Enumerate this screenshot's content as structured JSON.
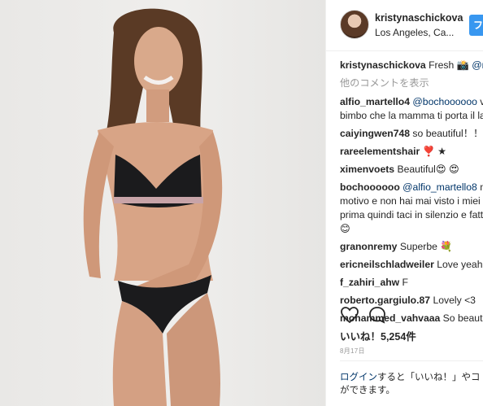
{
  "post": {
    "username": "kristynaschickova",
    "location": "Los Angeles, Ca...",
    "follow_label": "フ"
  },
  "caption": {
    "username": "kristynaschickova",
    "text": " Fresh 📸 ",
    "mention": "@n"
  },
  "view_more": "他のコメントを表示",
  "comments": [
    {
      "username": "alfio_martello4",
      "mention": " @bochoooooo",
      "text": " va",
      "line2": "bimbo che la mamma ti porta il la"
    },
    {
      "username": "caiyingwen748",
      "text": " so beautiful！！"
    },
    {
      "username": "rareelementshair",
      "text": " ❣️ ★"
    },
    {
      "username": "ximenvoets",
      "text": " Beautiful😍 😍"
    },
    {
      "username": "bochoooooo",
      "mention": " @alfio_martello8",
      "text": " no",
      "line2": "motivo e non hai mai visto i miei c",
      "line3": "prima quindi taci in silenzio e fatt",
      "line4": "😊"
    },
    {
      "username": "granonremy",
      "text": " Superbe 💐"
    },
    {
      "username": "ericneilschladweiler",
      "text": " Love yeah"
    },
    {
      "username": "f_zahiri_ahw",
      "text": " F"
    },
    {
      "username": "roberto.gargiulo.87",
      "text": " Lovely <3"
    },
    {
      "username": "mohammed_vahvaaa",
      "text": " So beautif"
    }
  ],
  "actions": {
    "like_icon": "heart-icon",
    "comment_icon": "speech-bubble-icon"
  },
  "likes": "いいね！5,254件",
  "date": "8月17日",
  "login": {
    "link": "ログイン",
    "text1": "すると「いいね！」やコ",
    "text2": "ができます。"
  }
}
